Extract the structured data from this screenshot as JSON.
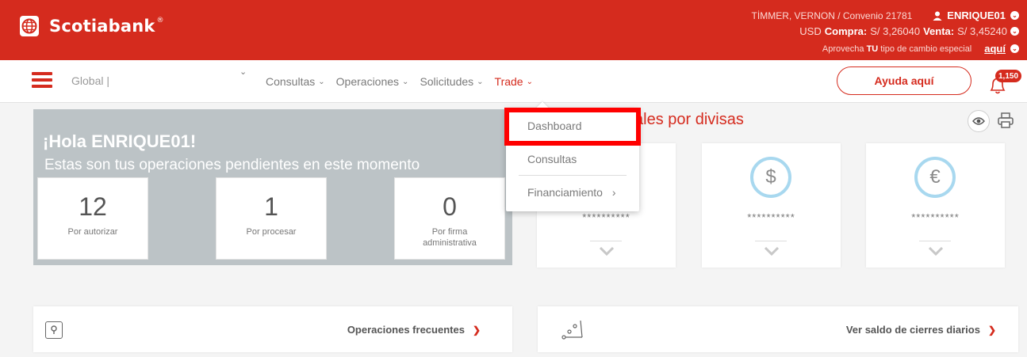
{
  "header": {
    "brand": "Scotiabank",
    "brand_mark": "®",
    "client": "TİMMER, VERNON / Convenio 21781",
    "user": "ENRIQUE01",
    "fx": {
      "currency": "USD",
      "buy_label": "Compra:",
      "buy_value": "S/ 3,26040",
      "sell_label": "Venta:",
      "sell_value": "S/ 3,45240"
    },
    "promo_prefix": "Aprovecha",
    "promo_bold": "TU",
    "promo_suffix": "tipo de cambio especial",
    "promo_link": "aquí"
  },
  "nav": {
    "global": "Global  |",
    "menu": [
      "Consultas",
      "Operaciones",
      "Solicitudes",
      "Trade"
    ],
    "help_button": "Ayuda aquí",
    "notifications": "1,150"
  },
  "dropdown": {
    "items": [
      "Dashboard",
      "Consultas",
      "Financiamiento"
    ]
  },
  "hola": {
    "title": "¡Hola ENRIQUE01!",
    "subtitle": "Estas son tus operaciones pendientes en este momento",
    "stats": [
      {
        "value": "12",
        "label": "Por autorizar"
      },
      {
        "value": "1",
        "label": "Por procesar"
      },
      {
        "value": "0",
        "label": "Por firma administrativa"
      }
    ]
  },
  "balances": {
    "title": "ales por divisas",
    "cards": [
      {
        "symbol": "",
        "masked": "**********"
      },
      {
        "symbol": "$",
        "masked": "**********"
      },
      {
        "symbol": "€",
        "masked": "**********"
      }
    ]
  },
  "bottom": {
    "frequent": "Operaciones frecuentes",
    "daily": "Ver saldo de cierres diarios"
  },
  "colors": {
    "brand_red": "#d52b1e",
    "highlight": "#ff0000",
    "panel_gray": "#bcc3c6",
    "currency_ring": "#a8d8ef"
  }
}
